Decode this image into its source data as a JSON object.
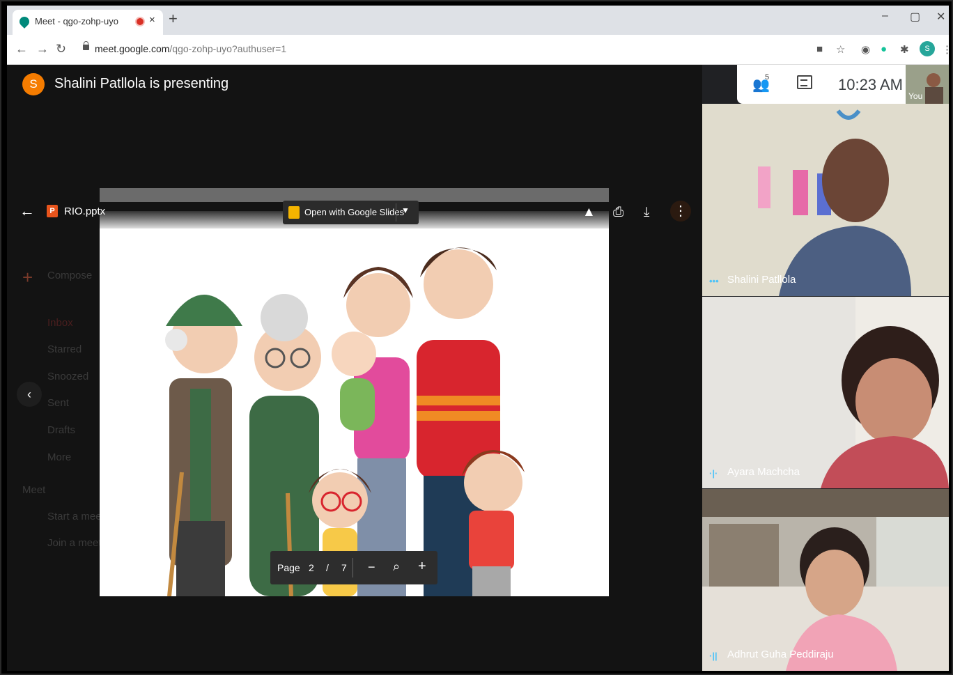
{
  "browser": {
    "tab_title": "Meet - qgo-zohp-uyo",
    "tab_close": "×",
    "new_tab": "+",
    "window_controls": [
      "–",
      "▢",
      "✕"
    ],
    "url_host": "meet.google.com",
    "url_path": "/qgo-zohp-uyo?authuser=1",
    "profile_initial": "S"
  },
  "meet": {
    "presenter_initial": "S",
    "presenter_text": "Shalini Patllola is presenting",
    "time": "10:23 AM",
    "participant_count": "5",
    "self_label": "You",
    "viewer": {
      "filename": "RIO.pptx",
      "open_with_label": "Open with Google Slides",
      "page_label": "Page",
      "current_page": "2",
      "page_sep": "/",
      "total_pages": "7"
    },
    "background_gmail": {
      "compose": "Compose",
      "items": [
        "Inbox",
        "Starred",
        "Snoozed",
        "Sent",
        "Drafts",
        "More"
      ],
      "meet_header": "Meet",
      "meet_items": [
        "Start a meet",
        "Join a meeti"
      ]
    },
    "participants": [
      {
        "name": "Shalini Patllola",
        "indicator": "•••"
      },
      {
        "name": "Ayara Machcha",
        "indicator": "·|·"
      },
      {
        "name": "Adhrut Guha Peddiraju",
        "indicator": "·||"
      }
    ]
  },
  "colors": {
    "presenter_avatar": "#f57c00",
    "stage_bg": "#131313",
    "accent_indicator": "#4fc3f7"
  }
}
